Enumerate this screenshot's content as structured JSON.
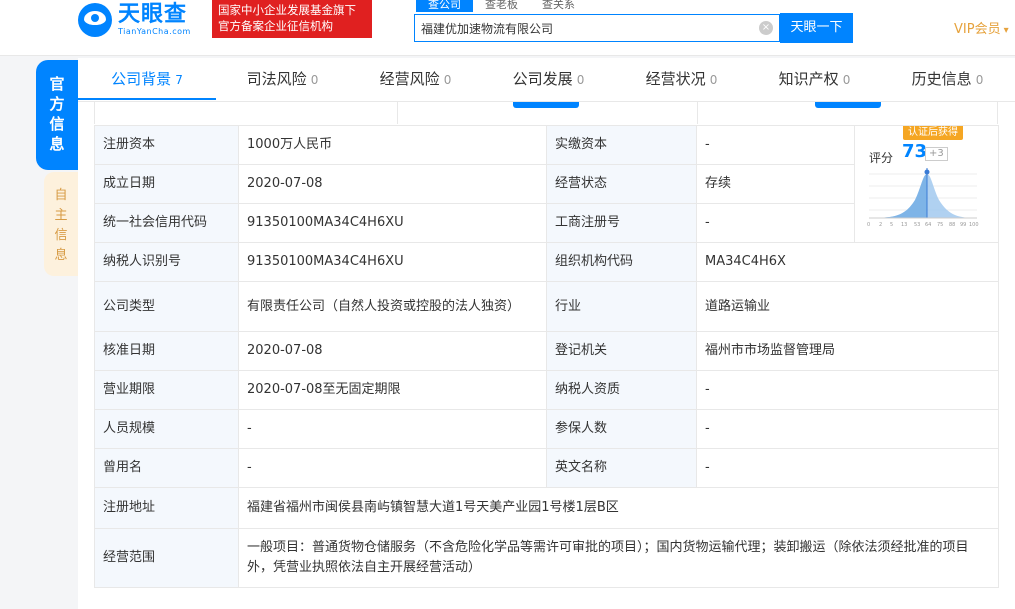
{
  "header": {
    "logo_cn": "天眼查",
    "logo_en": "TianYanCha.com",
    "badge_line1": "国家中小企业发展基金旗下",
    "badge_line2": "官方备案企业征信机构",
    "search_tabs": [
      "查公司",
      "查老板",
      "查关系"
    ],
    "search_value": "福建优加速物流有限公司",
    "search_button": "天眼一下",
    "vip_label": "VIP会员"
  },
  "side": {
    "official": "官方信息",
    "self": "自主信息"
  },
  "tabs": [
    {
      "label": "公司背景",
      "count": "7"
    },
    {
      "label": "司法风险",
      "count": "0"
    },
    {
      "label": "经营风险",
      "count": "0"
    },
    {
      "label": "公司发展",
      "count": "0"
    },
    {
      "label": "经营状况",
      "count": "0"
    },
    {
      "label": "知识产权",
      "count": "0"
    },
    {
      "label": "历史信息",
      "count": "0"
    }
  ],
  "score": {
    "cert_tag": "认证后获得",
    "label": "评分",
    "value": "73",
    "delta": "+3",
    "axis_ticks": [
      "0",
      "2",
      "5",
      "13",
      "53",
      "64",
      "75",
      "88",
      "99",
      "100"
    ]
  },
  "info": {
    "reg_capital_label": "注册资本",
    "reg_capital": "1000万人民币",
    "paid_capital_label": "实缴资本",
    "paid_capital": "-",
    "est_date_label": "成立日期",
    "est_date": "2020-07-08",
    "status_label": "经营状态",
    "status": "存续",
    "credit_code_label": "统一社会信用代码",
    "credit_code": "91350100MA34C4H6XU",
    "biz_reg_no_label": "工商注册号",
    "biz_reg_no": "-",
    "taxpayer_id_label": "纳税人识别号",
    "taxpayer_id": "91350100MA34C4H6XU",
    "org_code_label": "组织机构代码",
    "org_code": "MA34C4H6X",
    "company_type_label": "公司类型",
    "company_type": "有限责任公司（自然人投资或控股的法人独资）",
    "industry_label": "行业",
    "industry": "道路运输业",
    "approve_date_label": "核准日期",
    "approve_date": "2020-07-08",
    "reg_authority_label": "登记机关",
    "reg_authority": "福州市市场监督管理局",
    "biz_term_label": "营业期限",
    "biz_term": "2020-07-08至无固定期限",
    "taxpayer_qual_label": "纳税人资质",
    "taxpayer_qual": "-",
    "staff_size_label": "人员规模",
    "staff_size": "-",
    "insured_label": "参保人数",
    "insured": "-",
    "former_name_label": "曾用名",
    "former_name": "-",
    "english_name_label": "英文名称",
    "english_name": "-",
    "address_label": "注册地址",
    "address": "福建省福州市闽侯县南屿镇智慧大道1号天美产业园1号楼1层B区",
    "scope_label": "经营范围",
    "scope": "一般项目：普通货物仓储服务（不含危险化学品等需许可审批的项目）；国内货物运输代理；装卸搬运（除依法须经批准的项目外，凭营业执照依法自主开展经营活动）"
  }
}
